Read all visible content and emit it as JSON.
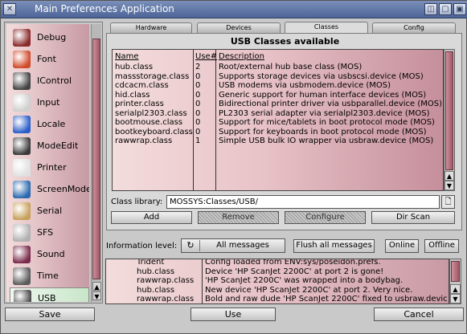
{
  "window": {
    "title": "Main Preferences Application"
  },
  "sidebar": {
    "items": [
      {
        "label": "Debug",
        "icon": "debug-icon",
        "color": "#8a2a2a"
      },
      {
        "label": "Font",
        "icon": "font-icon",
        "color": "#d14a2a"
      },
      {
        "label": "IControl",
        "icon": "icontrol-icon",
        "color": "#444444"
      },
      {
        "label": "Input",
        "icon": "mouse-icon",
        "color": "#cfcfcf"
      },
      {
        "label": "Locale",
        "icon": "globe-icon",
        "color": "#2a5ec9"
      },
      {
        "label": "ModeEdit",
        "icon": "monitor-icon",
        "color": "#3a3a3a"
      },
      {
        "label": "Printer",
        "icon": "printer-icon",
        "color": "#e0e0e0"
      },
      {
        "label": "ScreenMode",
        "icon": "screen-icon",
        "color": "#2a6ab0"
      },
      {
        "label": "Serial",
        "icon": "serial-icon",
        "color": "#c8a05a"
      },
      {
        "label": "SFS",
        "icon": "sfs-icon",
        "color": "#b0b0b0"
      },
      {
        "label": "Sound",
        "icon": "speaker-icon",
        "color": "#7a2a4a"
      },
      {
        "label": "Time",
        "icon": "clock-icon",
        "color": "#5a5a5a"
      },
      {
        "label": "USB",
        "icon": "usb-icon",
        "color": "#4a4a4a"
      }
    ],
    "selected": "USB"
  },
  "tabs": [
    "Hardware",
    "Devices",
    "Classes",
    "Config"
  ],
  "active_tab": "Classes",
  "panel_title": "USB Classes available",
  "class_list": {
    "headers": [
      "Name",
      "Use#",
      "Description"
    ],
    "rows": [
      {
        "name": "hub.class",
        "use": "2",
        "desc": "Root/external hub base class (MOS)"
      },
      {
        "name": "massstorage.class",
        "use": "0",
        "desc": "Supports storage devices via usbscsi.device (MOS)"
      },
      {
        "name": "cdcacm.class",
        "use": "0",
        "desc": "USB modems via usbmodem.device (MOS)"
      },
      {
        "name": "hid.class",
        "use": "0",
        "desc": "Generic support for human interface devices (MOS)"
      },
      {
        "name": "printer.class",
        "use": "0",
        "desc": "Bidirectional printer driver via usbparallel.device (MOS)"
      },
      {
        "name": "serialpl2303.class",
        "use": "0",
        "desc": "PL2303 serial adapter via serialpl2303.device (MOS)"
      },
      {
        "name": "bootmouse.class",
        "use": "0",
        "desc": "Support for mice/tablets in boot protocol mode (MOS)"
      },
      {
        "name": "bootkeyboard.class",
        "use": "0",
        "desc": "Support for keyboards in boot protocol mode (MOS)"
      },
      {
        "name": "rawwrap.class",
        "use": "1",
        "desc": "Simple USB bulk IO wrapper via usbraw.device (MOS)"
      }
    ]
  },
  "class_library": {
    "label": "Class library:",
    "value": "MOSSYS:Classes/USB/"
  },
  "class_buttons": {
    "add": "Add",
    "remove": "Remove",
    "configure": "Configure",
    "dirscan": "Dir Scan"
  },
  "info": {
    "label": "Information level:",
    "cycle_value": "All messages",
    "flush": "Flush all messages",
    "online": "Online",
    "offline": "Offline"
  },
  "log": [
    {
      "src": "Trident",
      "msg": "Config loaded from ENV:sys/poseidon.prefs."
    },
    {
      "src": "hub.class",
      "msg": "Device 'HP ScanJet 2200C' at port 2 is gone!"
    },
    {
      "src": "rawwrap.class",
      "msg": "'HP ScanJet 2200C' was wrapped into a bodybag."
    },
    {
      "src": "hub.class",
      "msg": "New device 'HP ScanJet 2200C' at port 2. Very nice."
    },
    {
      "src": "rawwrap.class",
      "msg": "Bold and raw dude 'HP ScanJet 2200C' fixed to usbraw.devic"
    }
  ],
  "bottom_buttons": {
    "save": "Save",
    "use": "Use",
    "cancel": "Cancel"
  }
}
